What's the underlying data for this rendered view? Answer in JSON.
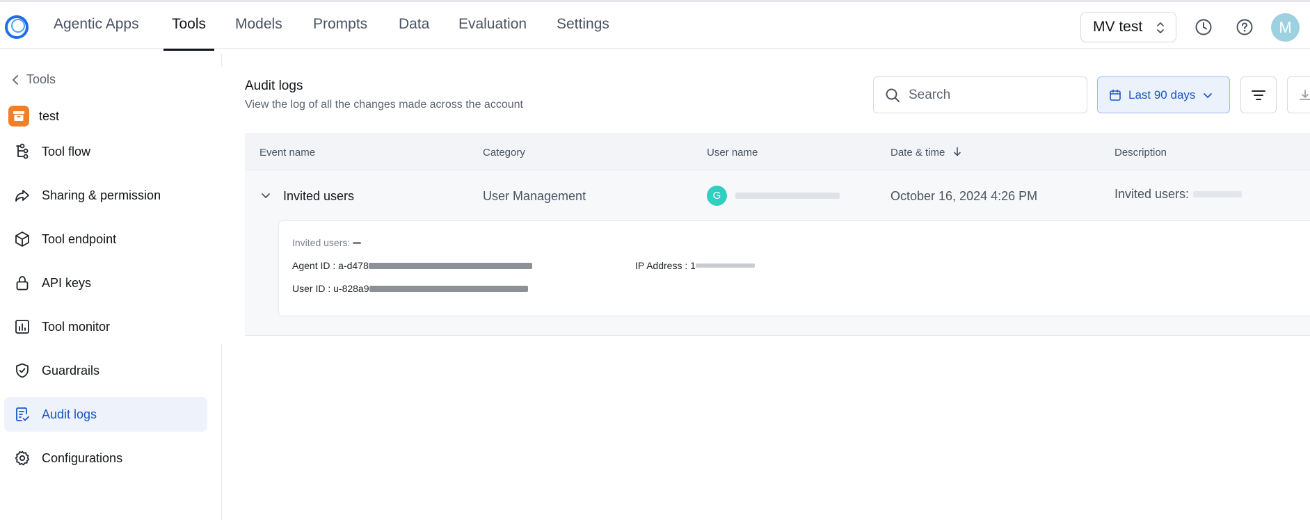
{
  "nav": {
    "tabs": [
      {
        "label": "Agentic Apps"
      },
      {
        "label": "Tools"
      },
      {
        "label": "Models"
      },
      {
        "label": "Prompts"
      },
      {
        "label": "Data"
      },
      {
        "label": "Evaluation"
      },
      {
        "label": "Settings"
      }
    ],
    "active_tab": "Tools",
    "workspace": "MV test",
    "user_initial": "M"
  },
  "sidebar": {
    "back_label": "Tools",
    "tool_name": "test",
    "items": [
      {
        "label": "Tool flow",
        "icon": "flow-icon"
      },
      {
        "label": "Sharing & permission",
        "icon": "share-icon"
      },
      {
        "label": "Tool endpoint",
        "icon": "cube-icon"
      },
      {
        "label": "API keys",
        "icon": "lock-icon"
      },
      {
        "label": "Tool monitor",
        "icon": "chart-icon"
      },
      {
        "label": "Guardrails",
        "icon": "shield-icon"
      },
      {
        "label": "Audit logs",
        "icon": "audit-icon"
      },
      {
        "label": "Configurations",
        "icon": "gear-icon"
      }
    ],
    "active_item": "Audit logs"
  },
  "main": {
    "title": "Audit logs",
    "subtitle": "View the log of all the changes made across the account",
    "search_placeholder": "Search",
    "date_range": "Last 90 days",
    "table": {
      "columns": [
        "Event name",
        "Category",
        "User name",
        "Date & time",
        "Description"
      ],
      "rows": [
        {
          "event": "Invited users",
          "category": "User Management",
          "user_initial": "G",
          "datetime": "October 16, 2024 4:26 PM",
          "description": "Invited users:",
          "details": {
            "invited_label": "Invited users:",
            "agent_id_label": "Agent ID : a-d478",
            "ip_label": "IP Address : 1",
            "user_id_label": "User ID : u-828a9"
          }
        }
      ]
    }
  },
  "colors": {
    "accent": "#1a56c4",
    "active_bg": "#eef2fb",
    "tool_badge": "#f07f2a",
    "user_avatar": "#2fcfc1",
    "profile_avatar": "#9ed1e0"
  }
}
